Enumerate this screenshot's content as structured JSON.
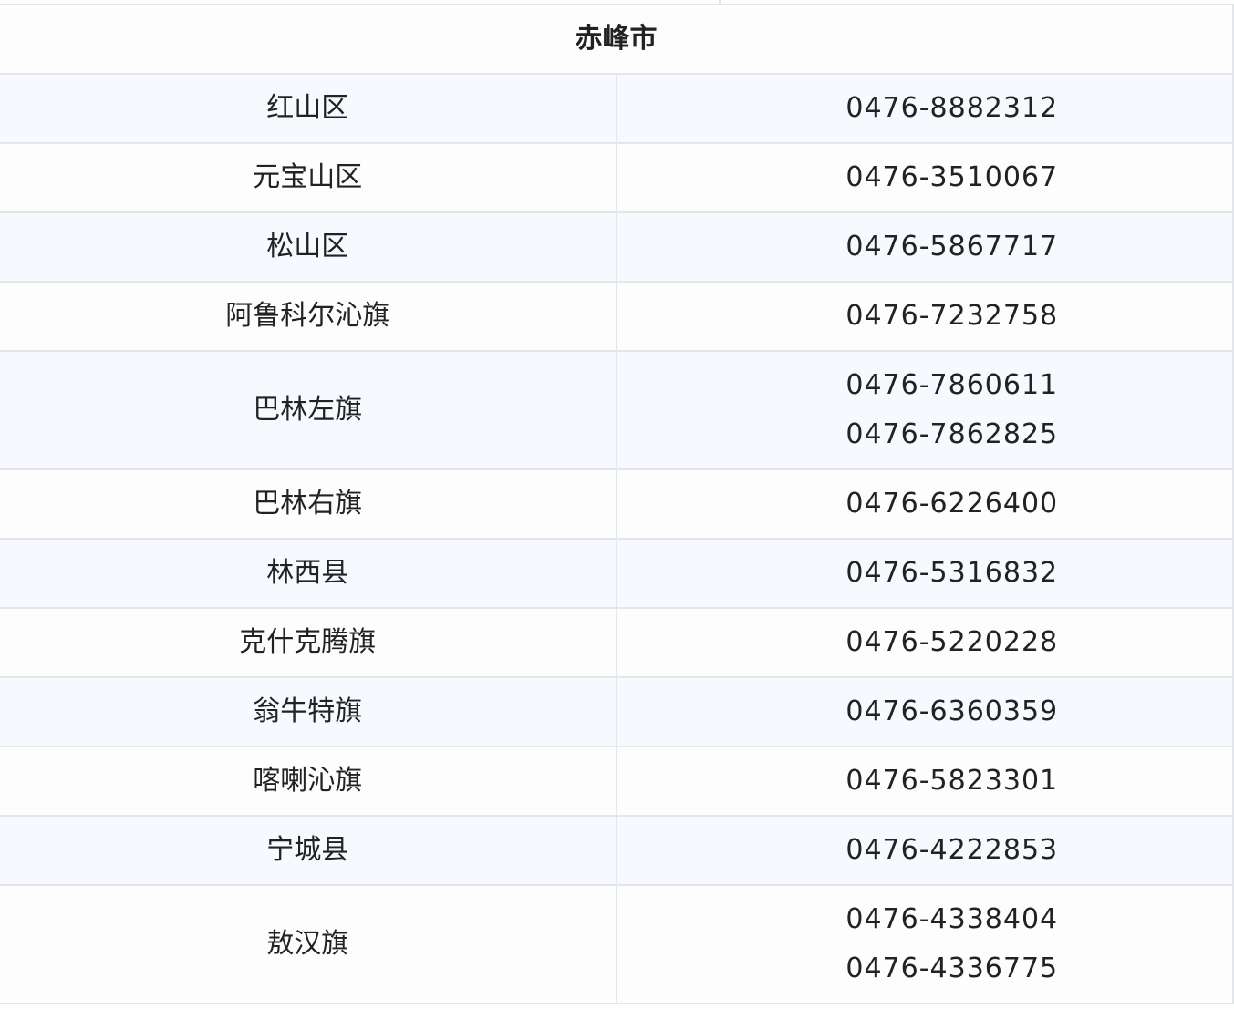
{
  "table": {
    "city": "赤峰市",
    "rows": [
      {
        "name": "红山区",
        "phones": [
          "0476-8882312"
        ]
      },
      {
        "name": "元宝山区",
        "phones": [
          "0476-3510067"
        ]
      },
      {
        "name": "松山区",
        "phones": [
          "0476-5867717"
        ]
      },
      {
        "name": "阿鲁科尔沁旗",
        "phones": [
          "0476-7232758"
        ]
      },
      {
        "name": "巴林左旗",
        "phones": [
          "0476-7860611",
          "0476-7862825"
        ]
      },
      {
        "name": "巴林右旗",
        "phones": [
          "0476-6226400"
        ]
      },
      {
        "name": "林西县",
        "phones": [
          "0476-5316832"
        ]
      },
      {
        "name": "克什克腾旗",
        "phones": [
          "0476-5220228"
        ]
      },
      {
        "name": "翁牛特旗",
        "phones": [
          "0476-6360359"
        ]
      },
      {
        "name": "喀喇沁旗",
        "phones": [
          "0476-5823301"
        ]
      },
      {
        "name": "宁城县",
        "phones": [
          "0476-4222853"
        ]
      },
      {
        "name": "敖汉旗",
        "phones": [
          "0476-4338404",
          "0476-4336775"
        ]
      }
    ]
  },
  "colors": {
    "border": "#e3e7ec",
    "row_tint": "#f6f9fd",
    "row_plain": "#fdfdfe",
    "text": "#222222"
  }
}
